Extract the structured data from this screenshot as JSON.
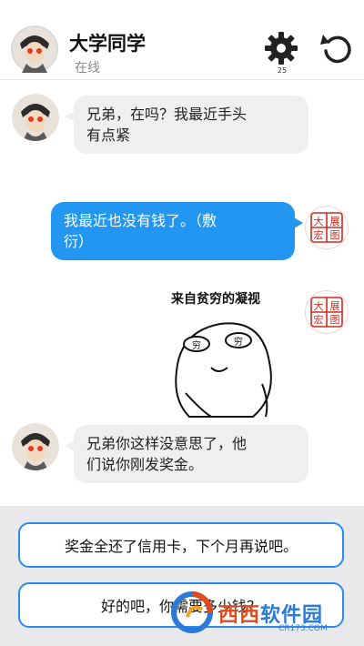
{
  "header": {
    "contact_name": "大学同学",
    "status": "在线",
    "settings_badge": "25",
    "settings_icon": "gear-icon",
    "refresh_icon": "refresh-icon"
  },
  "messages": [
    {
      "from": "contact",
      "text_line1": "兄弟，在吗？我最近手头",
      "text_line2": "有点紧"
    },
    {
      "from": "me",
      "text_line1": "我最近也没有钱了。（敷",
      "text_line2": "衍）"
    },
    {
      "from": "me",
      "type": "sticker",
      "caption": "来自贫穷的凝视",
      "eye_left": "穷",
      "eye_right": "穷"
    },
    {
      "from": "contact",
      "text_line1": "兄弟你这样没意思了，他",
      "text_line2": "们说你刚发奖金。"
    }
  ],
  "replies": [
    {
      "label": "奖金全还了信用卡，下个月再说吧。"
    },
    {
      "label": "好的吧，你需要多少钱？"
    }
  ],
  "seal_text": [
    "大",
    "展",
    "宏",
    "图"
  ],
  "watermark": {
    "text_red": "西西",
    "text_blue": "软件园",
    "url": "CR173.COM"
  },
  "colors": {
    "outgoing_bubble": "#2396f2",
    "incoming_bubble": "#efefef",
    "option_border": "#2a8bf0",
    "seal_red": "#d42b20"
  }
}
